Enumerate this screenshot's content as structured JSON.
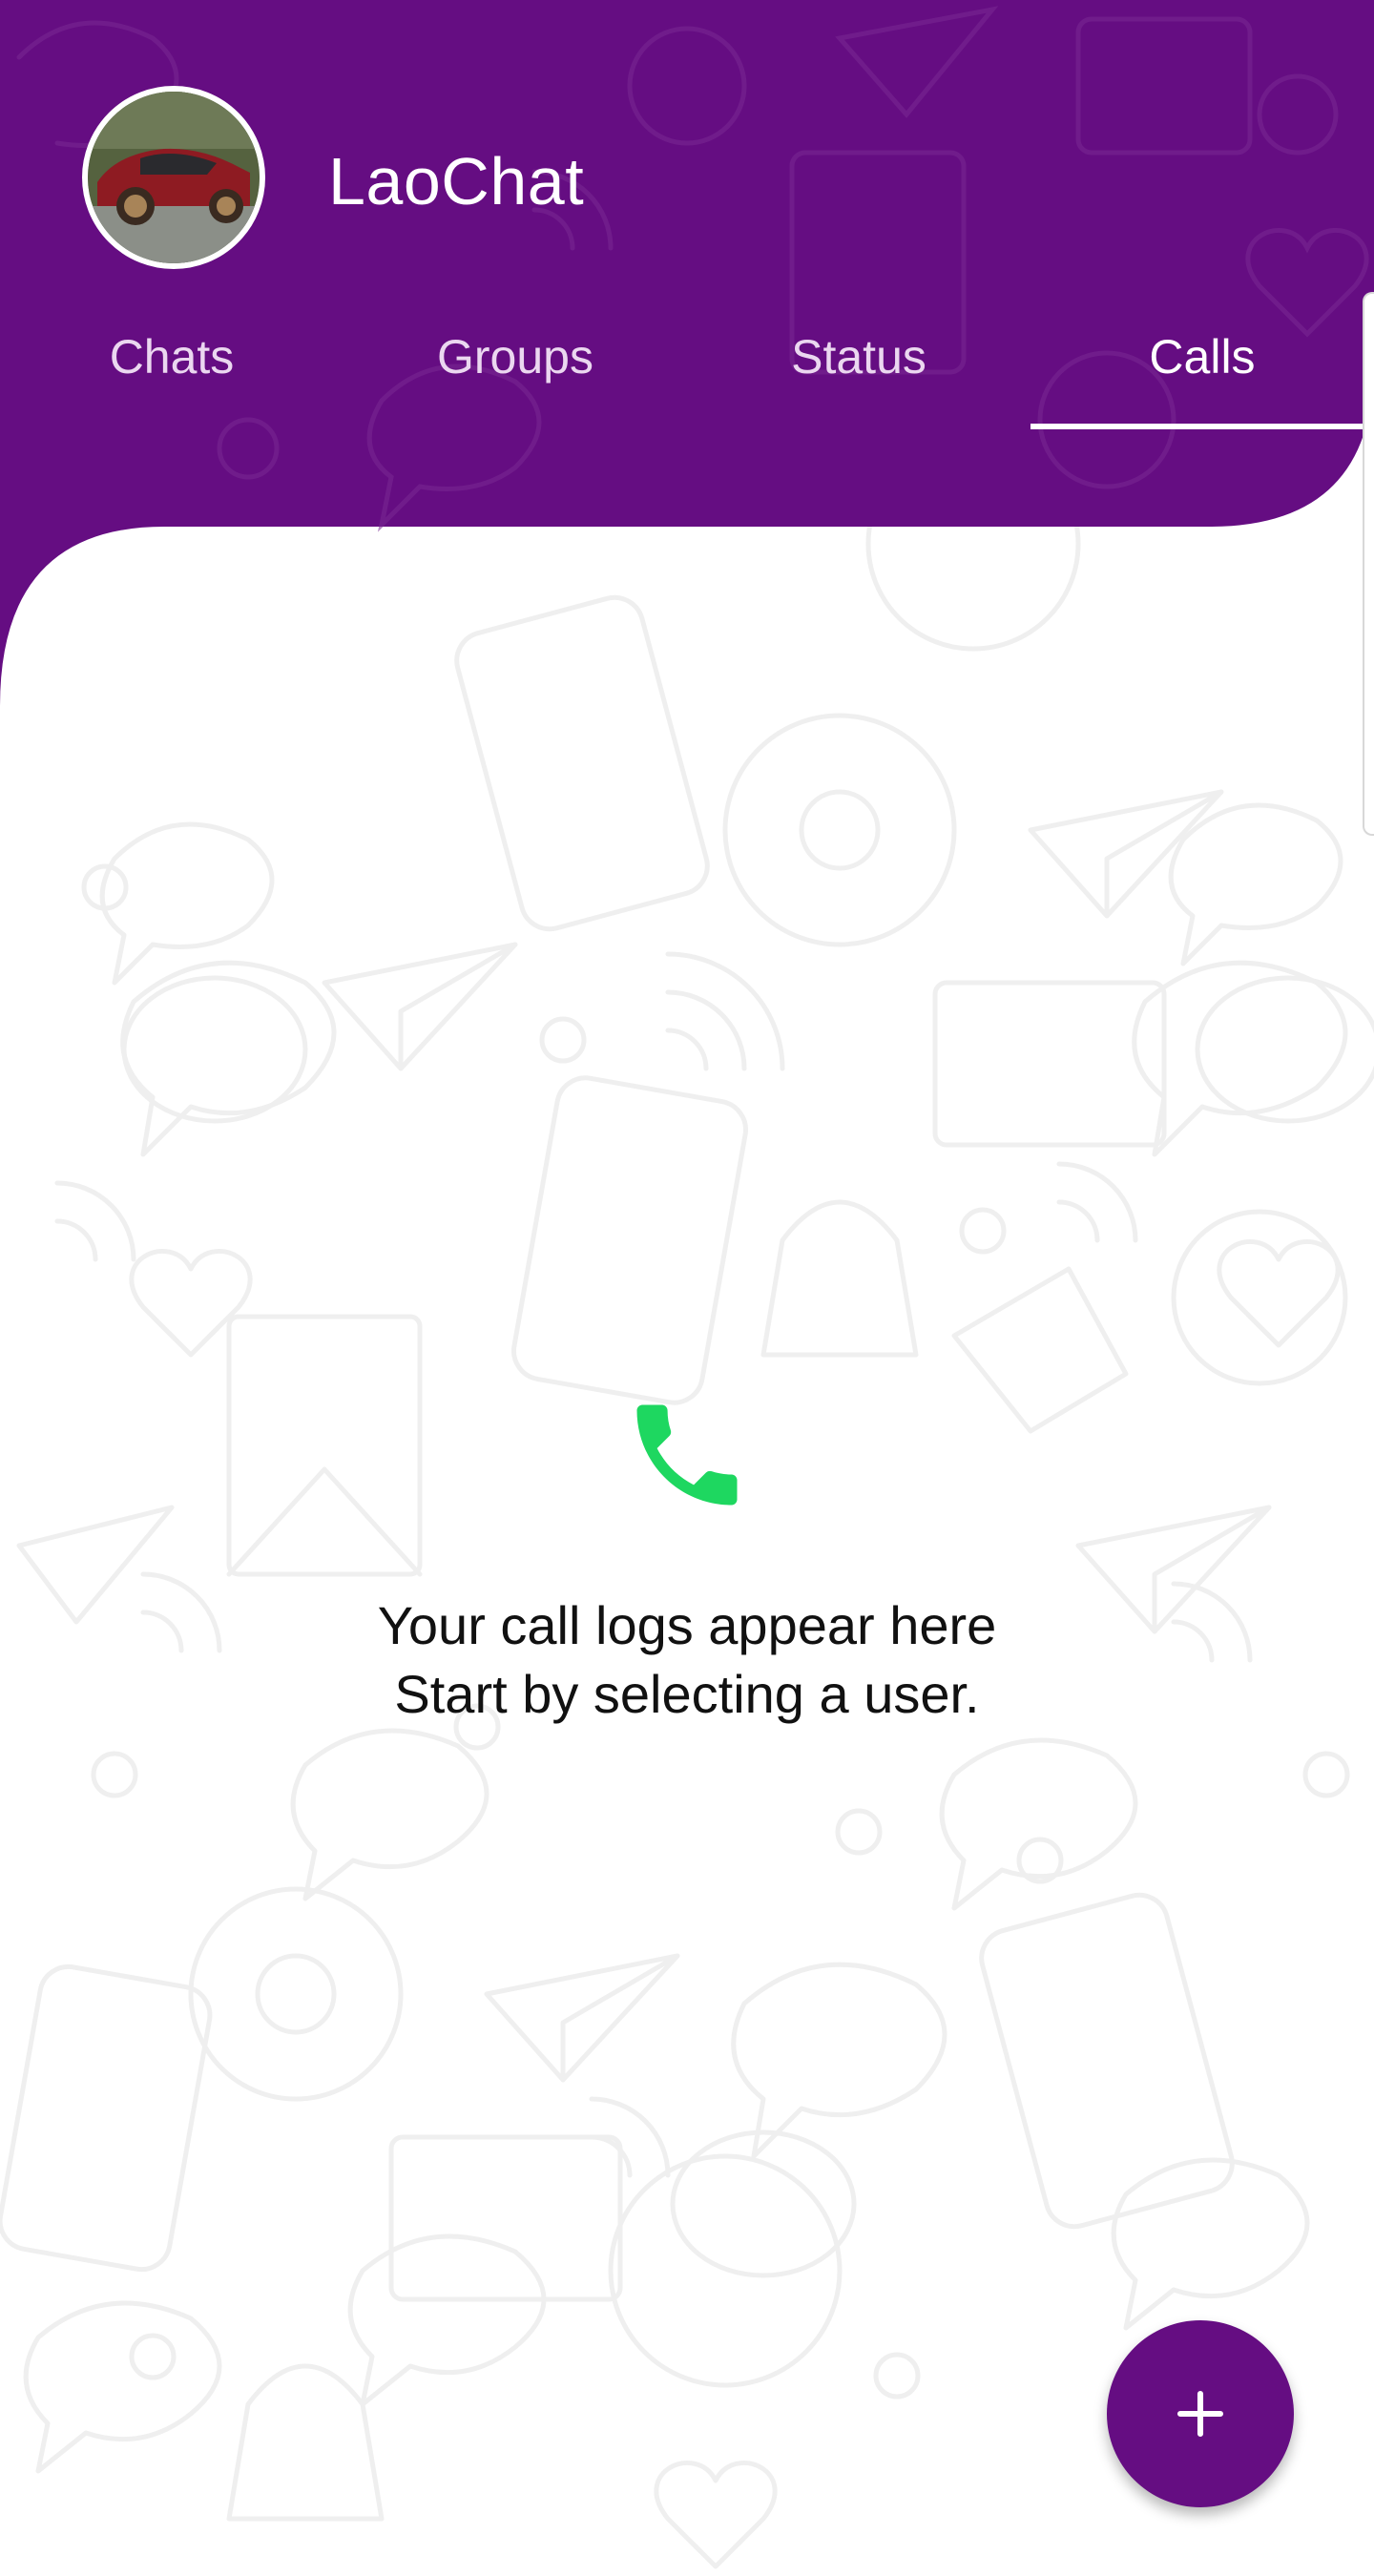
{
  "app": {
    "title": "LaoChat"
  },
  "tabs": [
    {
      "label": "Chats",
      "active": false
    },
    {
      "label": "Groups",
      "active": false
    },
    {
      "label": "Status",
      "active": false
    },
    {
      "label": "Calls",
      "active": true
    }
  ],
  "empty_state": {
    "line1": "Your call logs appear here",
    "line2": "Start by selecting a user.",
    "icon": "phone-icon"
  },
  "fab": {
    "icon": "plus-icon"
  },
  "colors": {
    "primary": "#650d82",
    "accent_green": "#1ed760",
    "text": "#111111",
    "inactive_tab": "#ebd7f0",
    "doodle_stroke": "#efefef"
  }
}
